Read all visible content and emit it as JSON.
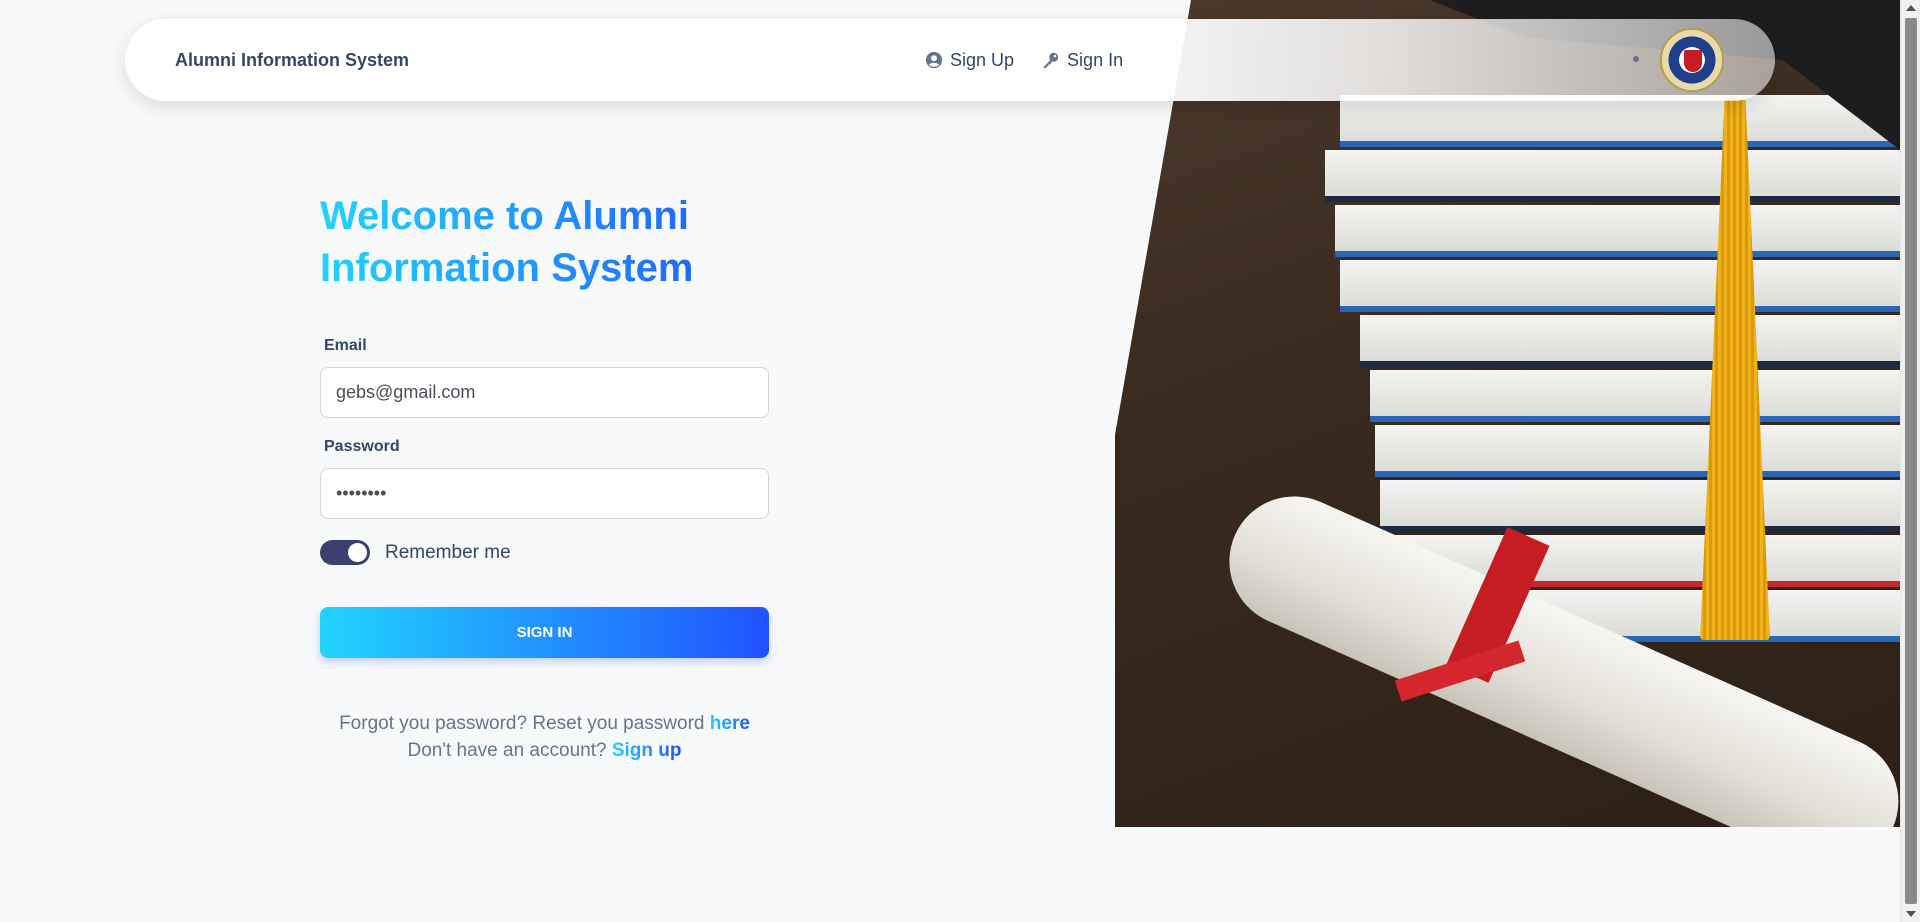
{
  "navbar": {
    "brand": "Alumni Information System",
    "links": [
      {
        "label": "Sign Up",
        "icon": "user-circle-icon"
      },
      {
        "label": "Sign In",
        "icon": "key-icon"
      }
    ]
  },
  "login": {
    "title_line1": "Welcome to Alumni",
    "title_line2": "Information System",
    "email_label": "Email",
    "email_value": "gebs@gmail.com",
    "password_label": "Password",
    "password_value": "••••••••",
    "remember_label": "Remember me",
    "remember_checked": true,
    "submit_label": "SIGN IN",
    "forgot_text": "Forgot you password? Reset you password ",
    "forgot_link": "here",
    "signup_text": "Don't have an account? ",
    "signup_link": "Sign up"
  },
  "colors": {
    "gradient_start": "#21d4fd",
    "gradient_end": "#2152ff",
    "toggle_on": "#3a416f",
    "text_dark": "#344767",
    "text_muted": "#67748e"
  }
}
